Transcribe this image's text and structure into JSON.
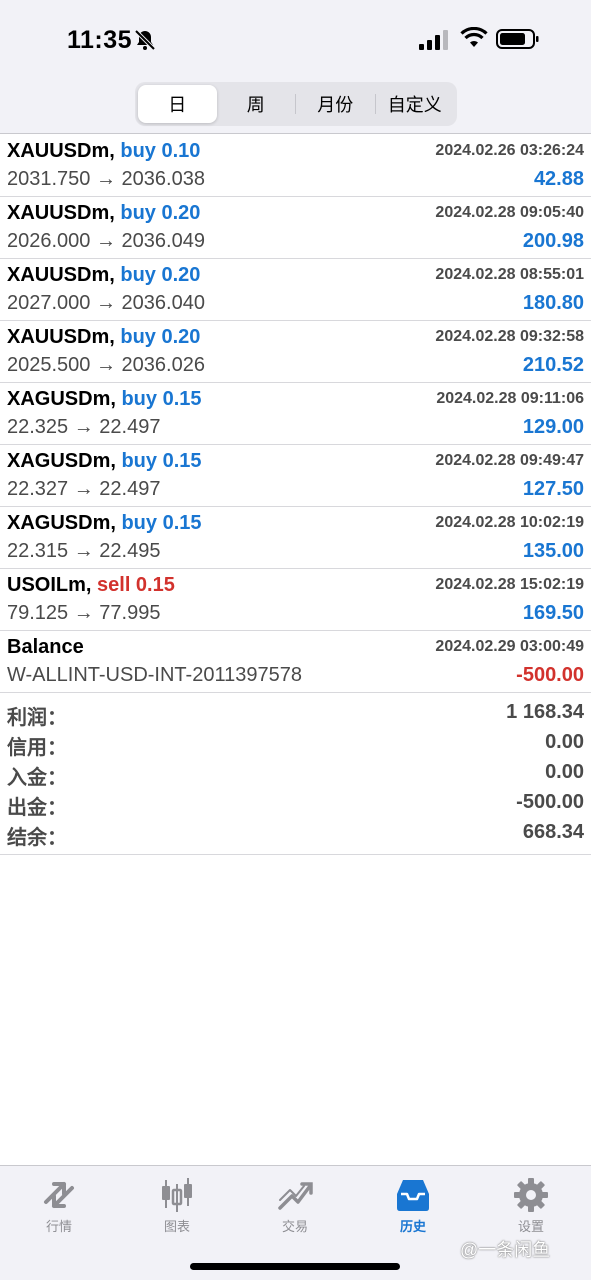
{
  "status_bar": {
    "time": "11:35"
  },
  "period_tabs": [
    {
      "label": "日",
      "active": true
    },
    {
      "label": "周",
      "active": false
    },
    {
      "label": "月份",
      "active": false
    },
    {
      "label": "自定义",
      "active": false
    }
  ],
  "trades": [
    {
      "symbol": "XAUUSDm,",
      "side": "buy 0.10",
      "type": "buy",
      "time": "2024.02.26 03:26:24",
      "prices": "2031.750 → 2036.038",
      "profit": "42.88"
    },
    {
      "symbol": "XAUUSDm,",
      "side": "buy 0.20",
      "type": "buy",
      "time": "2024.02.28 09:05:40",
      "prices": "2026.000 → 2036.049",
      "profit": "200.98"
    },
    {
      "symbol": "XAUUSDm,",
      "side": "buy 0.20",
      "type": "buy",
      "time": "2024.02.28 08:55:01",
      "prices": "2027.000 → 2036.040",
      "profit": "180.80"
    },
    {
      "symbol": "XAUUSDm,",
      "side": "buy 0.20",
      "type": "buy",
      "time": "2024.02.28 09:32:58",
      "prices": "2025.500 → 2036.026",
      "profit": "210.52"
    },
    {
      "symbol": "XAGUSDm,",
      "side": "buy 0.15",
      "type": "buy",
      "time": "2024.02.28 09:11:06",
      "prices": "22.325 → 22.497",
      "profit": "129.00"
    },
    {
      "symbol": "XAGUSDm,",
      "side": "buy 0.15",
      "type": "buy",
      "time": "2024.02.28 09:49:47",
      "prices": "22.327 → 22.497",
      "profit": "127.50"
    },
    {
      "symbol": "XAGUSDm,",
      "side": "buy 0.15",
      "type": "buy",
      "time": "2024.02.28 10:02:19",
      "prices": "22.315 → 22.495",
      "profit": "135.00"
    },
    {
      "symbol": "USOILm,",
      "side": "sell 0.15",
      "type": "sell",
      "time": "2024.02.28 15:02:19",
      "prices": "79.125 → 77.995",
      "profit": "169.50"
    }
  ],
  "balance_row": {
    "title": "Balance",
    "time": "2024.02.29 03:00:49",
    "comment": "W-ALLINT-USD-INT-2011397578",
    "amount": "-500.00"
  },
  "summary": [
    {
      "label": "利润：",
      "value": "1 168.34"
    },
    {
      "label": "信用：",
      "value": "0.00"
    },
    {
      "label": "入金：",
      "value": "0.00"
    },
    {
      "label": "出金：",
      "value": "-500.00"
    },
    {
      "label": "结余：",
      "value": "668.34"
    }
  ],
  "tabs": [
    {
      "label": "行情",
      "icon": "quotes-icon",
      "active": false
    },
    {
      "label": "图表",
      "icon": "chart-icon",
      "active": false
    },
    {
      "label": "交易",
      "icon": "trade-icon",
      "active": false
    },
    {
      "label": "历史",
      "icon": "history-icon",
      "active": true
    },
    {
      "label": "设置",
      "icon": "settings-icon",
      "active": false
    }
  ],
  "watermark": "@一条闲鱼",
  "colors": {
    "accent": "#1976d2",
    "negative": "#d2322d",
    "muted": "#8e8e93"
  }
}
